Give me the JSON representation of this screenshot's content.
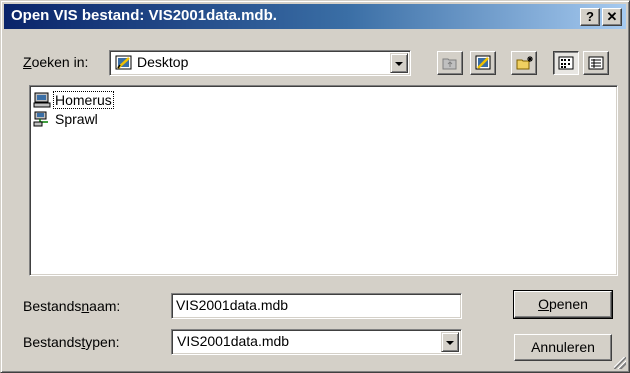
{
  "window": {
    "title": "Open VIS bestand: VIS2001data.mdb.",
    "help_button": "?",
    "close_button": "✕"
  },
  "lookin": {
    "label_accel": "Z",
    "label_rest": "oeken in:",
    "value": "Desktop",
    "icon": "desktop-icon"
  },
  "toolbar": {
    "buttons": [
      "up-folder-icon",
      "desktop-icon",
      "new-folder-icon",
      "list-view-icon",
      "details-view-icon"
    ],
    "pressed": "list-view-icon"
  },
  "files": {
    "items": [
      {
        "label": "Homerus",
        "icon": "computer-icon"
      },
      {
        "label": "Sprawl",
        "icon": "network-icon"
      }
    ]
  },
  "filename": {
    "label_pre": "Bestands",
    "label_accel": "n",
    "label_post": "aam:",
    "value": "VIS2001data.mdb"
  },
  "filetype": {
    "label_pre": "Bestands",
    "label_accel": "t",
    "label_post": "ypen:",
    "value": "VIS2001data.mdb"
  },
  "buttons": {
    "open_accel": "O",
    "open_rest": "penen",
    "cancel": "Annuleren"
  },
  "colors": {
    "title_start": "#0a246a",
    "title_end": "#a6caf0",
    "face": "#d4d0c8"
  }
}
